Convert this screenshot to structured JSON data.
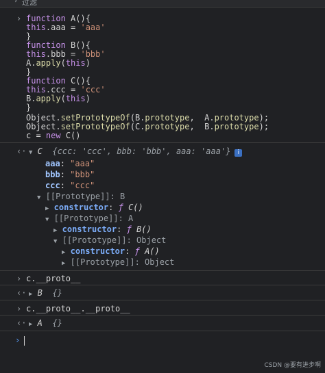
{
  "toolbar": {
    "filter_label": "过滤"
  },
  "code": {
    "l1": [
      "function",
      " A(){"
    ],
    "l2": [
      "this",
      ".aaa = ",
      "'aaa'"
    ],
    "l3": "}",
    "l4": [
      "function",
      " B(){"
    ],
    "l5": [
      "this",
      ".bbb = ",
      "'bbb'"
    ],
    "l6": [
      "A.",
      "apply",
      "(",
      "this",
      ")"
    ],
    "l7": "}",
    "l8": [
      "function",
      " C(){"
    ],
    "l9": [
      "this",
      ".ccc = ",
      "'ccc'"
    ],
    "l10": [
      "B.",
      "apply",
      "(",
      "this",
      ")"
    ],
    "l11": "}",
    "l12": [
      "Object.",
      "setPrototypeOf",
      "(B.",
      "prototype",
      ",  A.",
      "prototype",
      ");"
    ],
    "l13": [
      "Object.",
      "setPrototypeOf",
      "(C.",
      "prototype",
      ",  B.",
      "prototype",
      ");"
    ],
    "l14": [
      "c = ",
      "new",
      " C()"
    ]
  },
  "result": {
    "head_name": "C",
    "head_preview": "{ccc: 'ccc', bbb: 'bbb', aaa: 'aaa'}",
    "info": "i",
    "props": [
      {
        "key": "aaa",
        "val": "\"aaa\""
      },
      {
        "key": "bbb",
        "val": "\"bbb\""
      },
      {
        "key": "ccc",
        "val": "\"ccc\""
      }
    ],
    "proto1_label": "[[Prototype]]: B",
    "ctor1_key": "constructor",
    "ctor1_f": "ƒ",
    "ctor1_name": "C()",
    "proto2_label": "[[Prototype]]: A",
    "ctor2_key": "constructor",
    "ctor2_f": "ƒ",
    "ctor2_name": "B()",
    "proto3_label": "[[Prototype]]: Object",
    "ctor3_key": "constructor",
    "ctor3_f": "ƒ",
    "ctor3_name": "A()",
    "proto4_label": "[[Prototype]]: Object"
  },
  "entries": [
    {
      "input": "c.__proto__",
      "output_name": "B",
      "output_preview": "{}"
    },
    {
      "input": "c.__proto__.__proto__",
      "output_name": "A",
      "output_preview": "{}"
    }
  ],
  "watermark": "CSDN @要有进步啊"
}
